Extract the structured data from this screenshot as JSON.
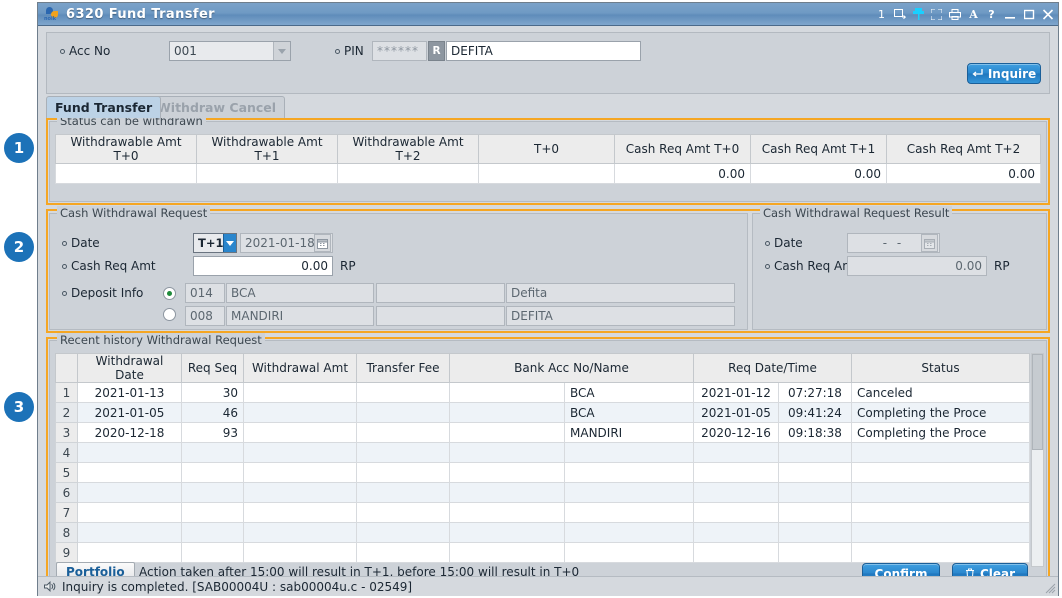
{
  "window": {
    "title": "6320 Fund Transfer",
    "logo_icon": "noik-logo-icon",
    "tool_icons": [
      {
        "name": "page-count",
        "label": "1"
      },
      {
        "name": "export-window-icon",
        "label": ""
      },
      {
        "name": "pin-icon",
        "label": ""
      },
      {
        "name": "expand-icon",
        "label": ""
      },
      {
        "name": "print-icon",
        "label": ""
      },
      {
        "name": "font-size-icon",
        "label": "A"
      },
      {
        "name": "help-icon",
        "label": "?"
      }
    ],
    "controls": {
      "minimize": "—",
      "maximize": "□",
      "close": "✕"
    }
  },
  "header": {
    "acc_no_label": "Acc No",
    "acc_no_value": "001",
    "pin_label": "PIN",
    "pin_value": "******",
    "r_button": "R",
    "name_value": "DEFITA",
    "inquire_button": "Inquire",
    "inquire_icon": "enter-key-icon"
  },
  "tabs": [
    {
      "label": "Fund Transfer",
      "active": true
    },
    {
      "label": "Withdraw Cancel",
      "active": false
    }
  ],
  "status_withdrawn": {
    "caption": "Status can be withdrawn",
    "columns": [
      "Withdrawable Amt T+0",
      "Withdrawable Amt T+1",
      "Withdrawable Amt T+2",
      "T+0",
      "Cash Req Amt T+0",
      "Cash Req Amt T+1",
      "Cash Req Amt T+2"
    ],
    "row": [
      "",
      "",
      "",
      "",
      "0.00",
      "0.00",
      "0.00"
    ]
  },
  "cash_request": {
    "caption": "Cash Withdrawal Request",
    "date_label": "Date",
    "date_type_value": "T+1",
    "date_value": "2021-01-18",
    "calendar_icon": "calendar-icon",
    "amt_label": "Cash Req Amt",
    "amt_value": "0.00",
    "currency": "RP",
    "deposit_label": "Deposit Info",
    "deposit_rows": [
      {
        "selected": true,
        "code": "014",
        "bank": "BCA",
        "acc_no": "",
        "holder": "Defita"
      },
      {
        "selected": false,
        "code": "008",
        "bank": "MANDIRI",
        "acc_no": "",
        "holder": "DEFITA"
      }
    ]
  },
  "cash_request_result": {
    "caption": "Cash Withdrawal Request Result",
    "date_label": "Date",
    "date_value": "-  -",
    "calendar_icon": "calendar-icon",
    "amt_label": "Cash Req Amt",
    "amt_value": "0.00",
    "currency": "RP"
  },
  "history": {
    "caption": "Recent history Withdrawal Request",
    "columns": [
      "",
      "Withdrawal Date",
      "Req Seq",
      "Withdrawal Amt",
      "Transfer Fee",
      "Bank Acc No/Name",
      "Req Date/Time",
      "",
      "Status"
    ],
    "rows": [
      {
        "no": "1",
        "date": "2021-01-13",
        "seq": "30",
        "amt": "",
        "fee": "",
        "bank_acc": "",
        "bank_name": "BCA",
        "req_date": "2021-01-12",
        "req_time": "07:27:18",
        "status": "Canceled"
      },
      {
        "no": "2",
        "date": "2021-01-05",
        "seq": "46",
        "amt": "",
        "fee": "",
        "bank_acc": "",
        "bank_name": "BCA",
        "req_date": "2021-01-05",
        "req_time": "09:41:24",
        "status": "Completing the Proce"
      },
      {
        "no": "3",
        "date": "2020-12-18",
        "seq": "93",
        "amt": "",
        "fee": "",
        "bank_acc": "",
        "bank_name": "MANDIRI",
        "req_date": "2020-12-16",
        "req_time": "09:18:38",
        "status": "Completing the Proce"
      },
      {
        "no": "4",
        "date": "",
        "seq": "",
        "amt": "",
        "fee": "",
        "bank_acc": "",
        "bank_name": "",
        "req_date": "",
        "req_time": "",
        "status": ""
      },
      {
        "no": "5",
        "date": "",
        "seq": "",
        "amt": "",
        "fee": "",
        "bank_acc": "",
        "bank_name": "",
        "req_date": "",
        "req_time": "",
        "status": ""
      },
      {
        "no": "6",
        "date": "",
        "seq": "",
        "amt": "",
        "fee": "",
        "bank_acc": "",
        "bank_name": "",
        "req_date": "",
        "req_time": "",
        "status": ""
      },
      {
        "no": "7",
        "date": "",
        "seq": "",
        "amt": "",
        "fee": "",
        "bank_acc": "",
        "bank_name": "",
        "req_date": "",
        "req_time": "",
        "status": ""
      },
      {
        "no": "8",
        "date": "",
        "seq": "",
        "amt": "",
        "fee": "",
        "bank_acc": "",
        "bank_name": "",
        "req_date": "",
        "req_time": "",
        "status": ""
      },
      {
        "no": "9",
        "date": "",
        "seq": "",
        "amt": "",
        "fee": "",
        "bank_acc": "",
        "bank_name": "",
        "req_date": "",
        "req_time": "",
        "status": ""
      }
    ]
  },
  "footer": {
    "portfolio_button": "Portfolio",
    "note": "Action taken after 15:00 will result in T+1, before 15:00 will result in T+0",
    "confirm_button": "Confirm",
    "clear_button": "Clear",
    "clear_icon": "trash-icon"
  },
  "statusbar": {
    "speaker_icon": "speaker-icon",
    "message": "Inquiry is completed. [SAB00004U : sab00004u.c - 02549]"
  },
  "annotations": [
    {
      "number": "1"
    },
    {
      "number": "2"
    },
    {
      "number": "3"
    }
  ],
  "colors": {
    "accent_orange": "#f5a623",
    "badge_blue": "#1c72b8",
    "button_blue": "#2a86cd"
  }
}
